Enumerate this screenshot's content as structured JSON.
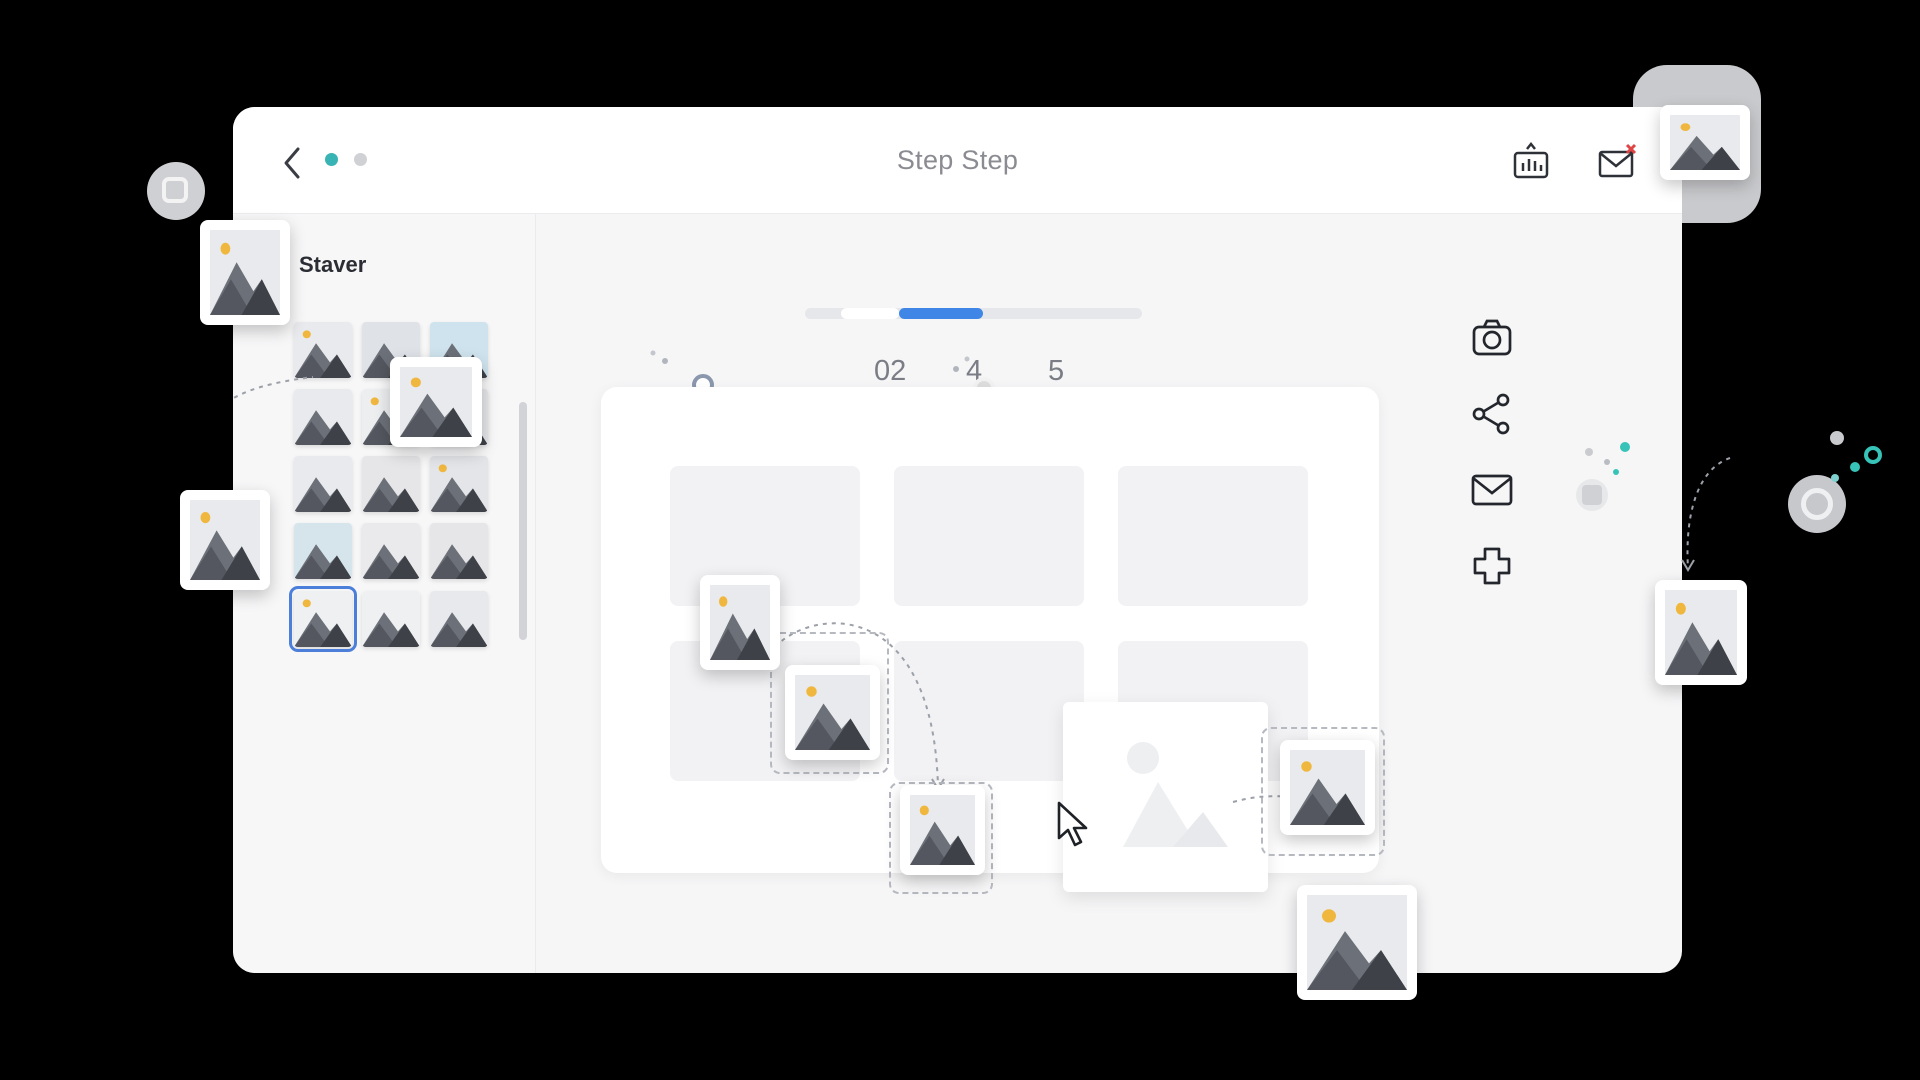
{
  "window": {
    "title": "Step Step"
  },
  "header": {
    "back_icon": "chevron-left-icon",
    "pager_dots": [
      "active",
      "inactive"
    ],
    "actions": [
      {
        "name": "chart-export-icon"
      },
      {
        "name": "mail-check-icon"
      }
    ]
  },
  "sidebar": {
    "title": "Staver",
    "thumbnail_count": 15,
    "selected_index": 12
  },
  "steps": {
    "labels": [
      "02",
      "4",
      "5"
    ],
    "progress_active": 2
  },
  "toolbar": {
    "items": [
      "camera-icon",
      "share-icon",
      "mail-icon",
      "puzzle-icon"
    ]
  },
  "colors": {
    "accent": "#3f86e6",
    "dot_active": "#39b4b4",
    "sun": "#f0b73f",
    "mountain": "#54575f",
    "close_x": "#e04545",
    "teal": "#38c3b8"
  }
}
